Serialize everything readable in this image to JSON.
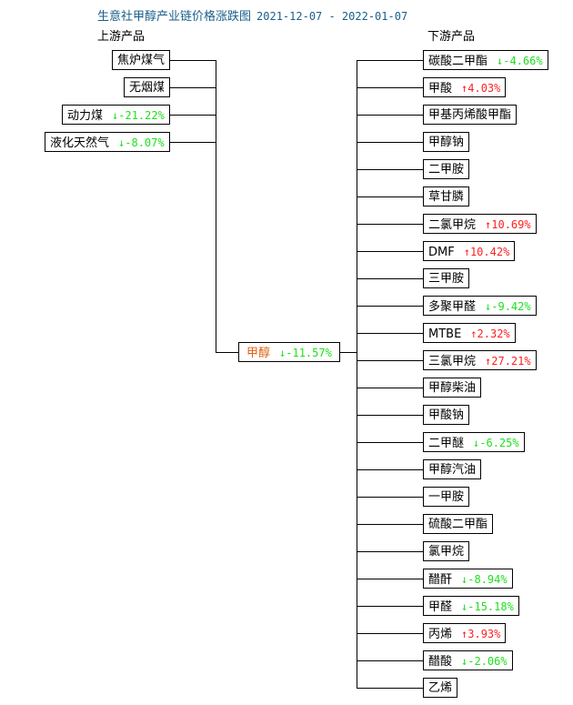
{
  "title": "生意社甲醇产业链价格涨跌图",
  "date_range": "2021-12-07 - 2022-01-07",
  "upstream_header": "上游产品",
  "downstream_header": "下游产品",
  "colors": {
    "up": "#ff2020",
    "down": "#20e020",
    "center": "#e06010",
    "title": "#1a5e8a"
  },
  "center": {
    "name": "甲醇",
    "change": "↓-11.57%",
    "direction": "down"
  },
  "upstream": [
    {
      "name": "焦炉煤气",
      "change": "",
      "direction": ""
    },
    {
      "name": "无烟煤",
      "change": "",
      "direction": ""
    },
    {
      "name": "动力煤",
      "change": "↓-21.22%",
      "direction": "down"
    },
    {
      "name": "液化天然气",
      "change": "↓-8.07%",
      "direction": "down"
    }
  ],
  "downstream": [
    {
      "name": "碳酸二甲酯",
      "change": "↓-4.66%",
      "direction": "down"
    },
    {
      "name": "甲酸",
      "change": "↑4.03%",
      "direction": "up"
    },
    {
      "name": "甲基丙烯酸甲酯",
      "change": "",
      "direction": ""
    },
    {
      "name": "甲醇钠",
      "change": "",
      "direction": ""
    },
    {
      "name": "二甲胺",
      "change": "",
      "direction": ""
    },
    {
      "name": "草甘膦",
      "change": "",
      "direction": ""
    },
    {
      "name": "二氯甲烷",
      "change": "↑10.69%",
      "direction": "up"
    },
    {
      "name": "DMF",
      "change": "↑10.42%",
      "direction": "up"
    },
    {
      "name": "三甲胺",
      "change": "",
      "direction": ""
    },
    {
      "name": "多聚甲醛",
      "change": "↓-9.42%",
      "direction": "down"
    },
    {
      "name": "MTBE",
      "change": "↑2.32%",
      "direction": "up"
    },
    {
      "name": "三氯甲烷",
      "change": "↑27.21%",
      "direction": "up"
    },
    {
      "name": "甲醇柴油",
      "change": "",
      "direction": ""
    },
    {
      "name": "甲酸钠",
      "change": "",
      "direction": ""
    },
    {
      "name": "二甲醚",
      "change": "↓-6.25%",
      "direction": "down"
    },
    {
      "name": "甲醇汽油",
      "change": "",
      "direction": ""
    },
    {
      "name": "一甲胺",
      "change": "",
      "direction": ""
    },
    {
      "name": "硫酸二甲酯",
      "change": "",
      "direction": ""
    },
    {
      "name": "氯甲烷",
      "change": "",
      "direction": ""
    },
    {
      "name": "醋酐",
      "change": "↓-8.94%",
      "direction": "down"
    },
    {
      "name": "甲醛",
      "change": "↓-15.18%",
      "direction": "down"
    },
    {
      "name": "丙烯",
      "change": "↑3.93%",
      "direction": "up"
    },
    {
      "name": "醋酸",
      "change": "↓-2.06%",
      "direction": "down"
    },
    {
      "name": "乙烯",
      "change": "",
      "direction": ""
    }
  ]
}
